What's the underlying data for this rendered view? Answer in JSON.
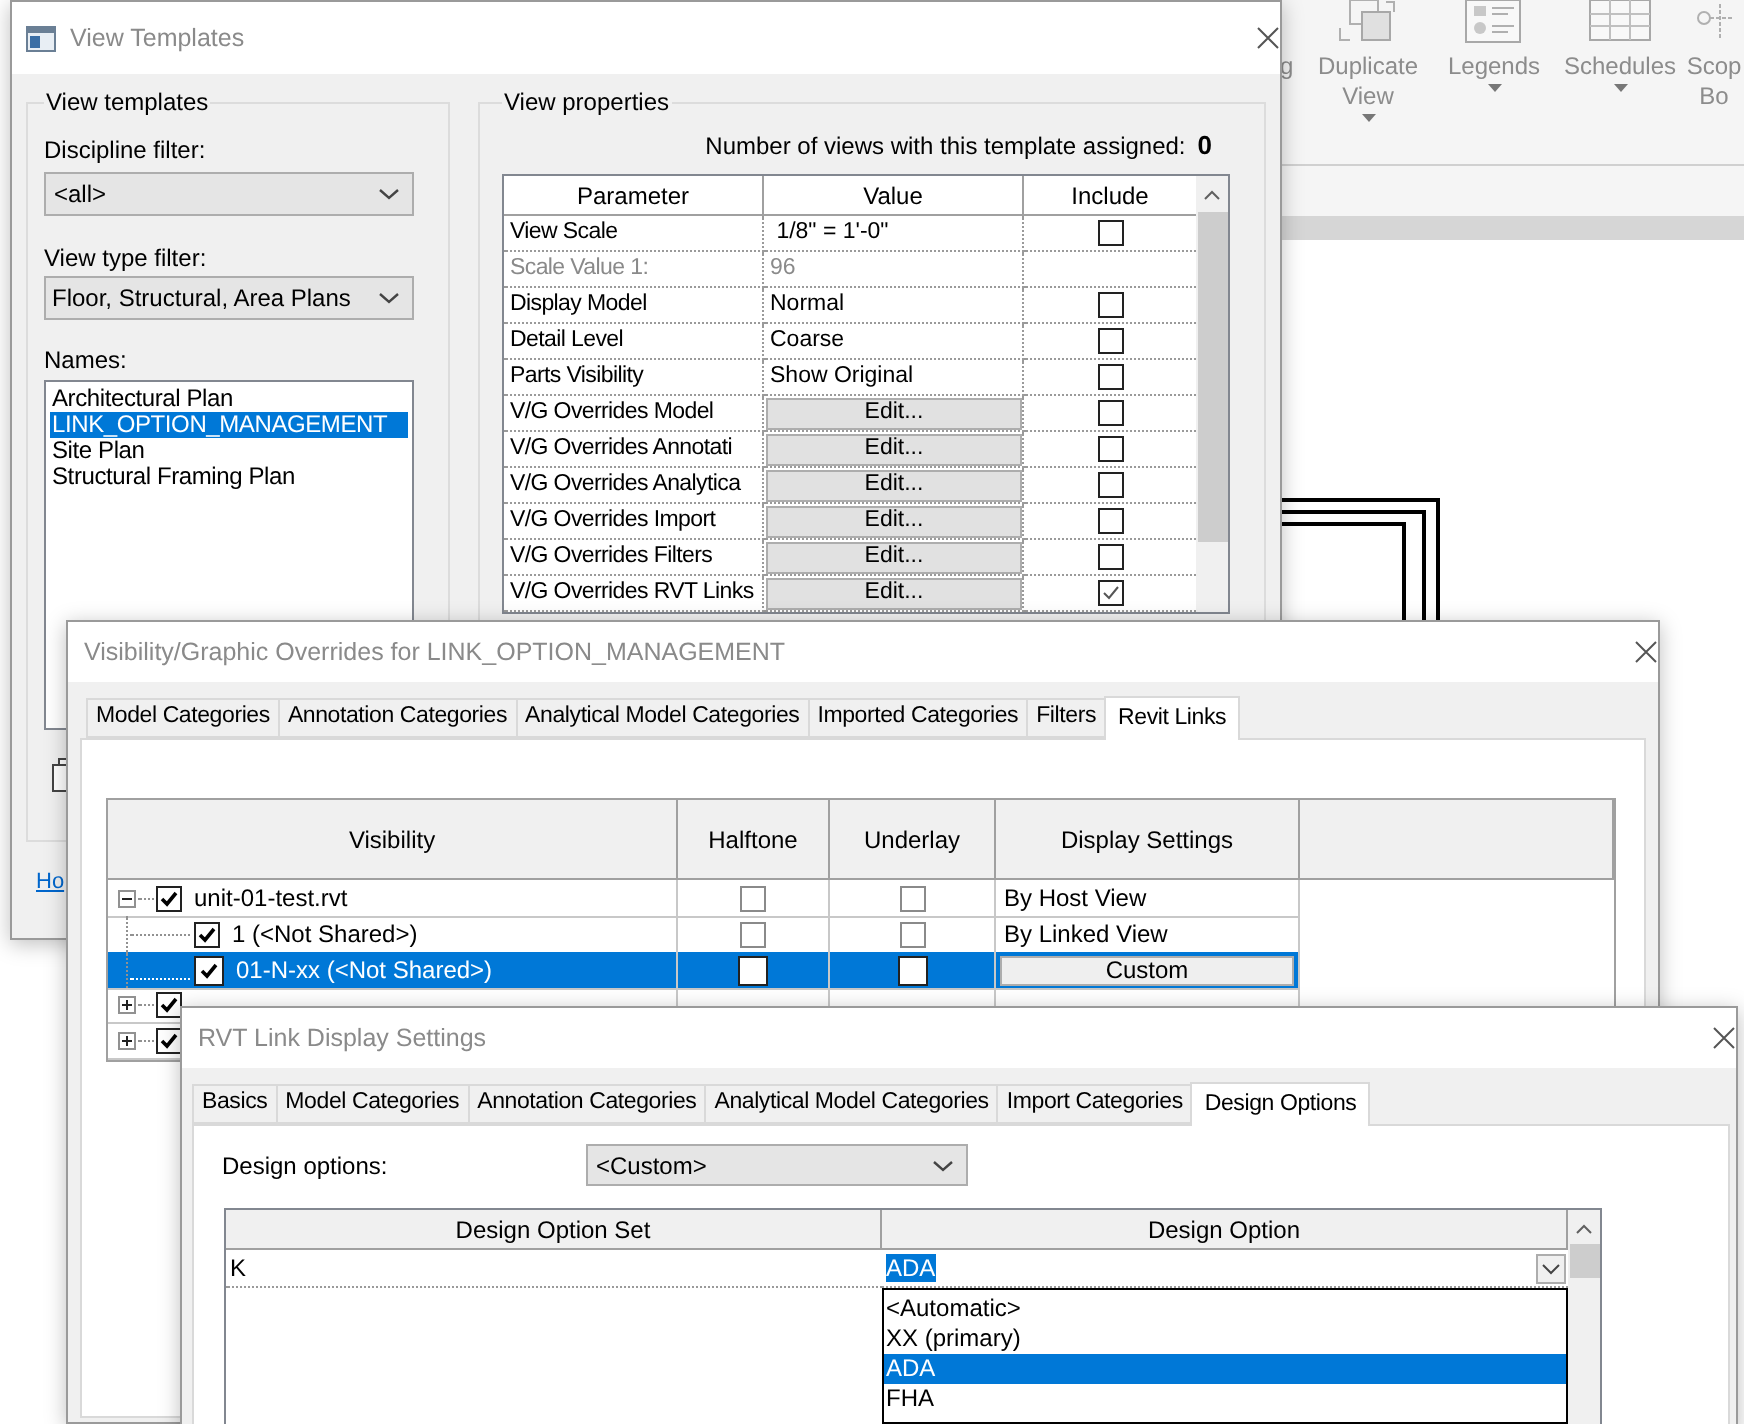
{
  "ribbon": {
    "buttons": [
      {
        "kind": "partial",
        "lines": [
          "g"
        ],
        "dropdown": false
      },
      {
        "kind": "duplicate",
        "lines": [
          "Duplicate",
          "View"
        ],
        "dropdown": true
      },
      {
        "kind": "legends",
        "lines": [
          "Legends"
        ],
        "dropdown": true
      },
      {
        "kind": "schedules",
        "lines": [
          "Schedules"
        ],
        "dropdown": true
      },
      {
        "kind": "scope",
        "lines": [
          "Scop",
          "Bo"
        ],
        "dropdown": false
      }
    ]
  },
  "view_templates": {
    "title": "View Templates",
    "templates_group": {
      "title": "View templates",
      "discipline_filter": {
        "label": "Discipline filter:",
        "value": "<all>"
      },
      "view_type_filter": {
        "label": "View type filter:",
        "value": "Floor, Structural, Area Plans"
      },
      "names": {
        "label": "Names:",
        "items": [
          {
            "label": "Architectural Plan",
            "selected": false
          },
          {
            "label": "LINK_OPTION_MANAGEMENT",
            "selected": true
          },
          {
            "label": "Site Plan",
            "selected": false
          },
          {
            "label": "Structural Framing Plan",
            "selected": false
          }
        ]
      }
    },
    "help_link": "Ho",
    "properties": {
      "title": "View properties",
      "count_label": "Number of views with this template assigned:",
      "count": "0",
      "columns": [
        "Parameter",
        "Value",
        "Include"
      ],
      "rows": [
        {
          "parameter": "View Scale",
          "value": " 1/8\" = 1'-0\"",
          "kind": "text",
          "include": false
        },
        {
          "parameter": "Scale Value    1:",
          "value": "96",
          "kind": "readonly"
        },
        {
          "parameter": "Display Model",
          "value": "Normal",
          "kind": "text",
          "include": false
        },
        {
          "parameter": "Detail Level",
          "value": "Coarse",
          "kind": "text",
          "include": false
        },
        {
          "parameter": "Parts Visibility",
          "value": "Show Original",
          "kind": "text",
          "include": false
        },
        {
          "parameter": "V/G Overrides Model",
          "value": "Edit...",
          "kind": "button",
          "include": false
        },
        {
          "parameter": "V/G Overrides Annotati",
          "value": "Edit...",
          "kind": "button",
          "include": false
        },
        {
          "parameter": "V/G Overrides Analytica",
          "value": "Edit...",
          "kind": "button",
          "include": false
        },
        {
          "parameter": "V/G Overrides Import",
          "value": "Edit...",
          "kind": "button",
          "include": false
        },
        {
          "parameter": "V/G Overrides Filters",
          "value": "Edit...",
          "kind": "button",
          "include": false
        },
        {
          "parameter": "V/G Overrides RVT Links",
          "value": "Edit...",
          "kind": "button",
          "include": true
        }
      ]
    }
  },
  "vg_overrides": {
    "title": "Visibility/Graphic Overrides for LINK_OPTION_MANAGEMENT",
    "tabs": [
      {
        "label": "Model Categories",
        "selected": false
      },
      {
        "label": "Annotation Categories",
        "selected": false
      },
      {
        "label": "Analytical Model Categories",
        "selected": false
      },
      {
        "label": "Imported Categories",
        "selected": false
      },
      {
        "label": "Filters",
        "selected": false
      },
      {
        "label": "Revit Links",
        "selected": true
      }
    ],
    "columns": [
      "Visibility",
      "Halftone",
      "Underlay",
      "Display Settings"
    ],
    "rows": [
      {
        "name": "unit-01-test.rvt",
        "visible": true,
        "expanded": true,
        "halftone": false,
        "underlay": false,
        "display": {
          "label": "By Host View",
          "kind": "text"
        },
        "selected": false,
        "children": [
          {
            "name": "1 (<Not Shared>)",
            "visible": true,
            "halftone": false,
            "underlay": false,
            "display": {
              "label": "By Linked View",
              "kind": "text"
            },
            "selected": false
          },
          {
            "name": "01-N-xx (<Not Shared>)",
            "visible": true,
            "halftone": false,
            "underlay": false,
            "display": {
              "label": "Custom",
              "kind": "button"
            },
            "selected": true
          }
        ]
      },
      {
        "visible": true,
        "expanded": false,
        "selected": false
      },
      {
        "visible": true,
        "expanded": false,
        "selected": false
      }
    ]
  },
  "link_display": {
    "title": "RVT Link Display Settings",
    "tabs": [
      {
        "label": "Basics",
        "selected": false
      },
      {
        "label": "Model Categories",
        "selected": false
      },
      {
        "label": "Annotation Categories",
        "selected": false
      },
      {
        "label": "Analytical Model Categories",
        "selected": false
      },
      {
        "label": "Import Categories",
        "selected": false
      },
      {
        "label": "Design Options",
        "selected": true
      }
    ],
    "design_options": {
      "label": "Design options:",
      "value": "<Custom>"
    },
    "columns": [
      "Design Option Set",
      "Design Option"
    ],
    "rows": [
      {
        "set": "K",
        "option": "ADA",
        "editing": true
      }
    ],
    "dropdown": [
      {
        "label": "<Automatic>",
        "selected": false
      },
      {
        "label": "XX (primary)",
        "selected": false
      },
      {
        "label": "ADA",
        "selected": true
      },
      {
        "label": "FHA",
        "selected": false
      }
    ]
  }
}
